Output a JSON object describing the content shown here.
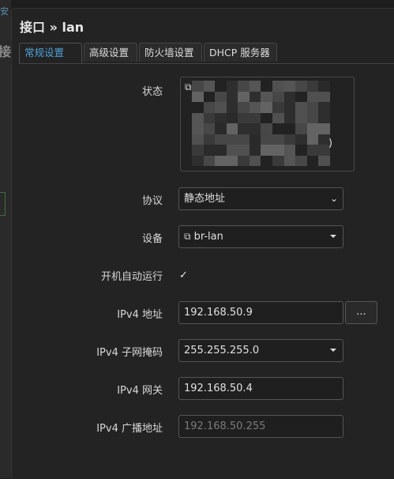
{
  "dialog": {
    "title": "接口 » lan"
  },
  "tabs": [
    {
      "label": "常规设置",
      "active": true
    },
    {
      "label": "高级设置",
      "active": false
    },
    {
      "label": "防火墙设置",
      "active": false
    },
    {
      "label": "DHCP 服务器",
      "active": false
    }
  ],
  "form": {
    "status": {
      "label": "状态",
      "icon": "network-device-icon",
      "trailing": ")"
    },
    "protocol": {
      "label": "协议",
      "value": "静态地址"
    },
    "device": {
      "label": "设备",
      "value": "br-lan",
      "icon": "network-device-icon"
    },
    "autostart": {
      "label": "开机自动运行",
      "checked": true
    },
    "ipv4_address": {
      "label": "IPv4 地址",
      "value": "192.168.50.9",
      "more_label": "..."
    },
    "ipv4_netmask": {
      "label": "IPv4 子网掩码",
      "value": "255.255.255.0"
    },
    "ipv4_gateway": {
      "label": "IPv4 网关",
      "value": "192.168.50.4"
    },
    "ipv4_broadcast": {
      "label": "IPv4 广播地址",
      "placeholder": "192.168.50.255"
    }
  },
  "colors": {
    "accent": "#4ea1d8",
    "background": "#232323",
    "field_border": "#555555"
  }
}
